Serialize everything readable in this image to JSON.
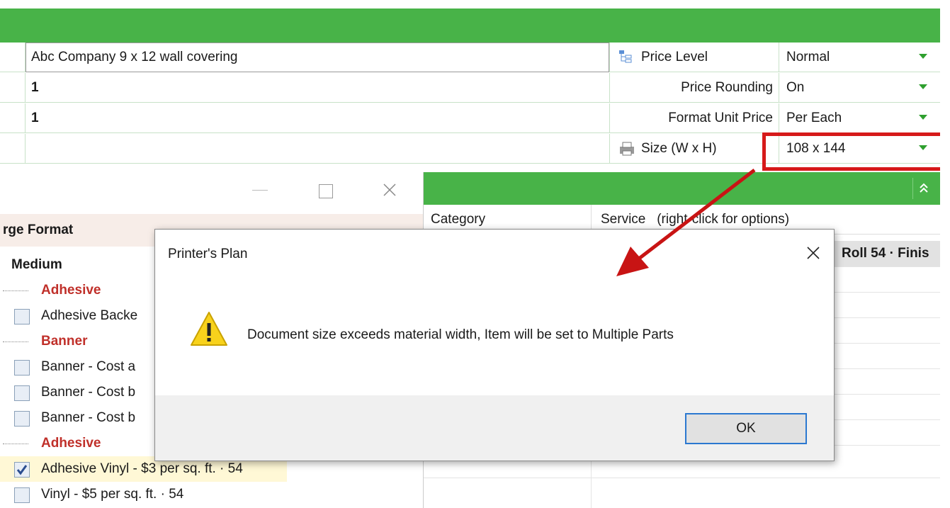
{
  "fields": {
    "description": "Abc Company 9 x 12 wall covering",
    "row2": "1",
    "row3": "1"
  },
  "properties": [
    {
      "label": "Price Level",
      "value": "Normal"
    },
    {
      "label": "Price Rounding",
      "value": "On"
    },
    {
      "label": "Format Unit Price",
      "value": "Per Each"
    },
    {
      "label": "Size (W x H)",
      "value": "108 x 144"
    }
  ],
  "left_panel": {
    "header": "rge Format",
    "group": "Medium",
    "items": [
      {
        "type": "section",
        "label": "Adhesive"
      },
      {
        "type": "item",
        "label": "Adhesive Backe",
        "checked": false
      },
      {
        "type": "section",
        "label": "Banner"
      },
      {
        "type": "item",
        "label": "Banner - Cost a",
        "checked": false
      },
      {
        "type": "item",
        "label": "Banner - Cost b",
        "checked": false
      },
      {
        "type": "item",
        "label": "Banner - Cost b",
        "checked": false
      },
      {
        "type": "section",
        "label": "Adhesive"
      },
      {
        "type": "item",
        "label": "Adhesive Vinyl - $3 per sq. ft. · 54",
        "checked": true
      },
      {
        "type": "item",
        "label": "Vinyl - $5 per sq. ft. · 54",
        "checked": false
      }
    ]
  },
  "right_grid": {
    "col_category": "Category",
    "col_service": "Service   (right-click for options)",
    "row1_fragment": "Roll 54 · Finis",
    "collapse_icon": "chevron-double-up"
  },
  "dialog": {
    "title": "Printer's Plan",
    "message": "Document size exceeds material width, Item will be set to Multiple Parts",
    "ok_label": "OK",
    "icon": "warning-icon"
  },
  "colors": {
    "green": "#48b348",
    "highlight": "#d61a1a"
  }
}
